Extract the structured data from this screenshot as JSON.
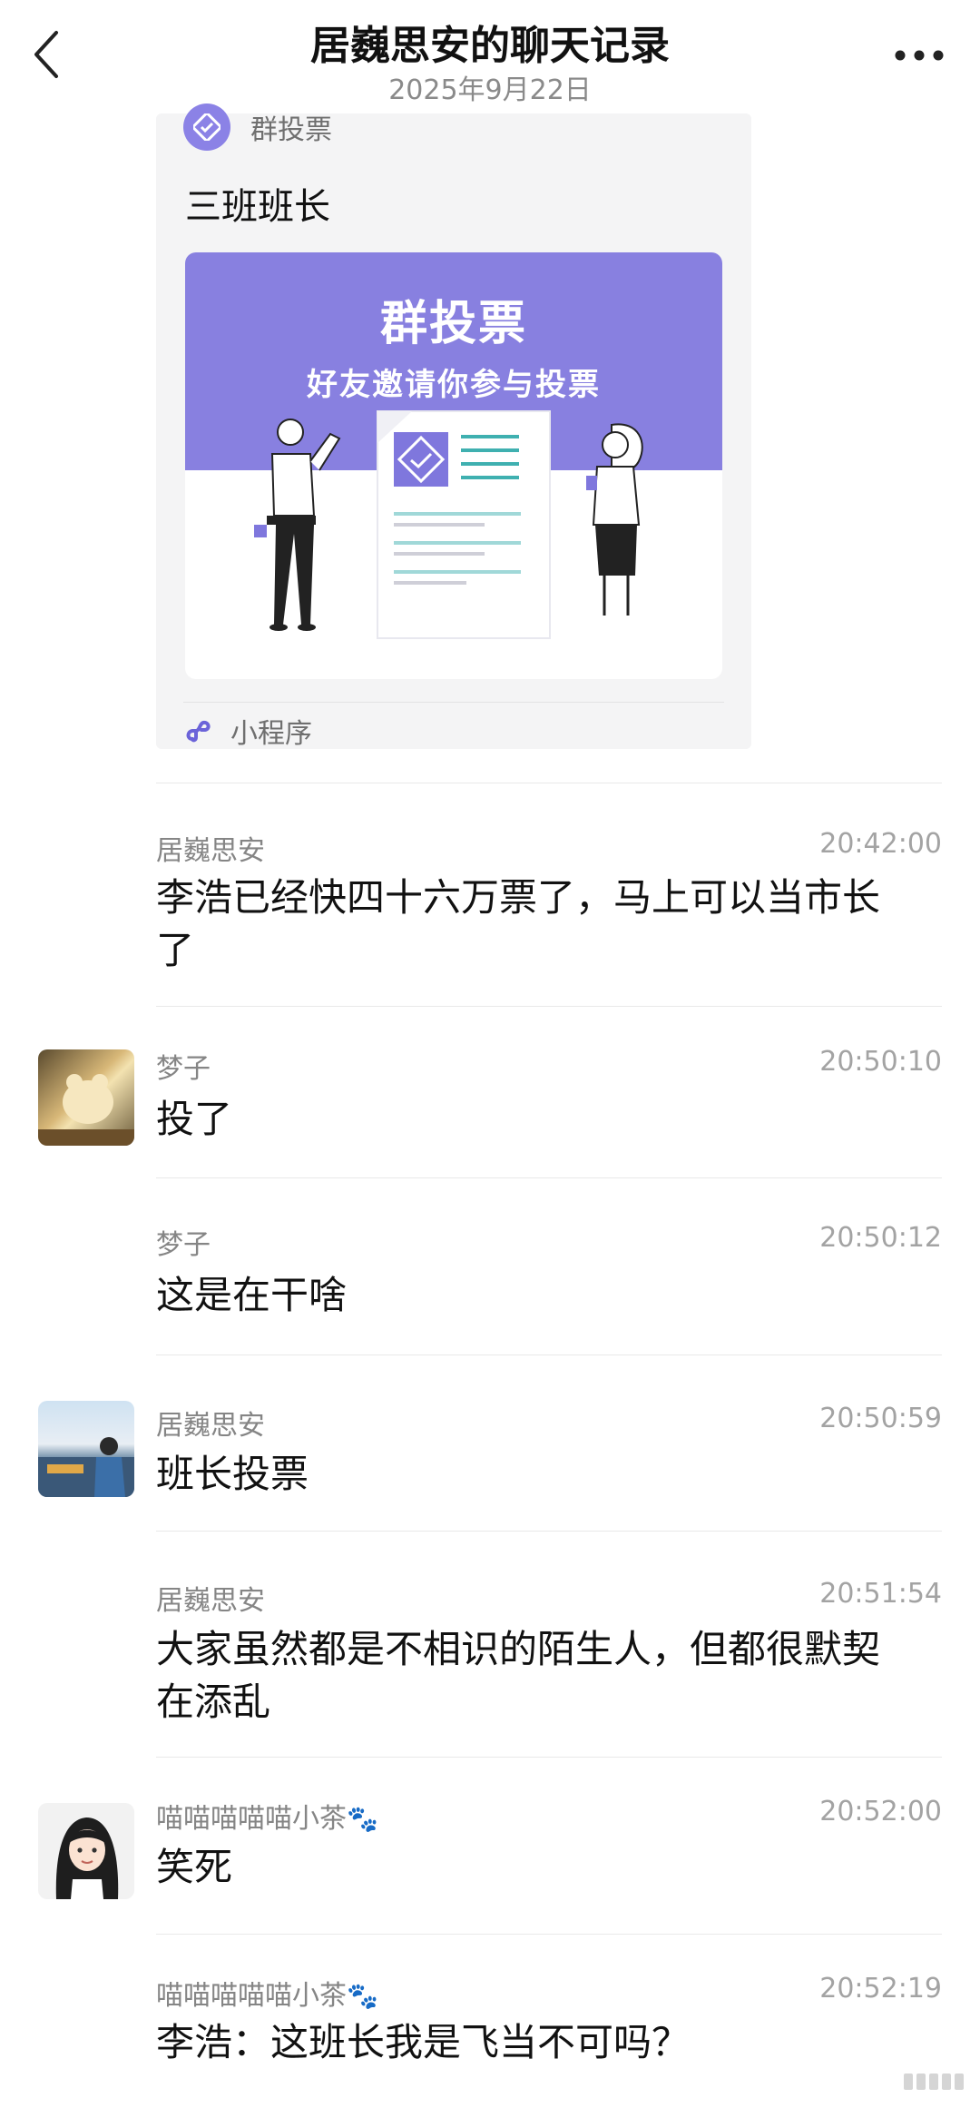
{
  "header": {
    "title": "居巍思安的聊天记录",
    "date": "2025年9月22日"
  },
  "vote_card": {
    "app_label": "群投票",
    "title": "三班班长",
    "poster_title": "群投票",
    "poster_subtitle": "好友邀请你参与投票",
    "footer_label": "小程序"
  },
  "messages": [
    {
      "sender": "居巍思安",
      "time": "20:42:00",
      "text": "李浩已经快四十六万票了，马上可以当市长了",
      "avatar": false
    },
    {
      "sender": "梦子",
      "time": "20:50:10",
      "text": "投了",
      "avatar": true
    },
    {
      "sender": "梦子",
      "time": "20:50:12",
      "text": "这是在干啥",
      "avatar": false
    },
    {
      "sender": "居巍思安",
      "time": "20:50:59",
      "text": "班长投票",
      "avatar": true
    },
    {
      "sender": "居巍思安",
      "time": "20:51:54",
      "text": "大家虽然都是不相识的陌生人，但都很默契在添乱",
      "avatar": false
    },
    {
      "sender": "喵喵喵喵喵小茶",
      "time": "20:52:00",
      "text": "笑死",
      "avatar": true
    },
    {
      "sender": "喵喵喵喵喵小茶",
      "time": "20:52:19",
      "text": "李浩：这班长我是飞当不可吗？",
      "avatar": false
    }
  ]
}
